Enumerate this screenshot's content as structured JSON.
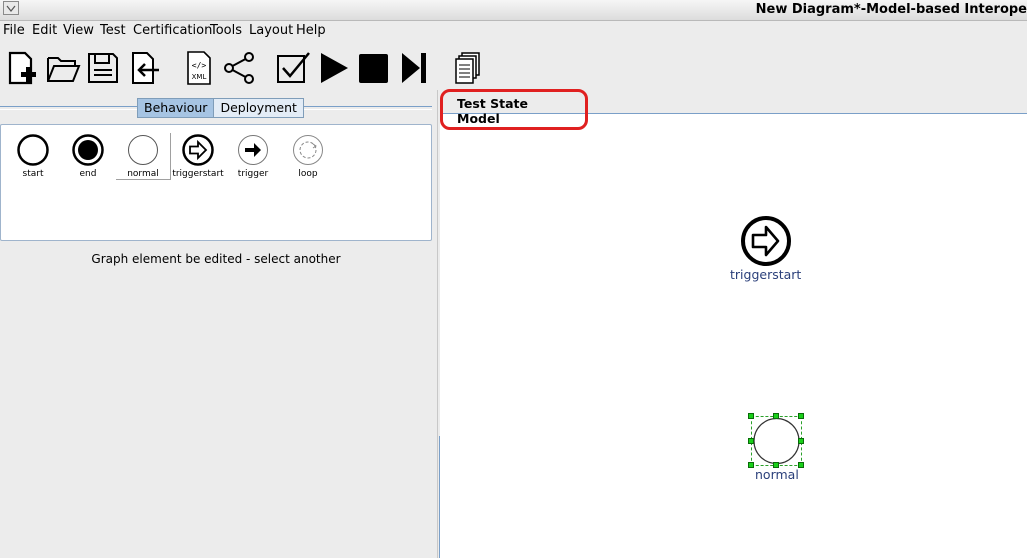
{
  "window": {
    "title": "New Diagram*-Model-based Interope"
  },
  "menu": [
    "File",
    "Edit",
    "View",
    "Test",
    "Certification",
    "Tools",
    "Layout",
    "Help"
  ],
  "toolbar": {
    "icons": [
      "new-icon",
      "open-folder-icon",
      "save-icon",
      "import-icon",
      "xml-icon",
      "share-icon",
      "validate-icon",
      "play-icon",
      "stop-icon",
      "step-icon",
      "copy-icon"
    ],
    "xml_text": "XML"
  },
  "left": {
    "tabs": [
      "Behaviour",
      "Deployment"
    ],
    "active_tab": "Behaviour",
    "palette": [
      "start",
      "end",
      "normal",
      "triggerstart",
      "trigger",
      "loop"
    ],
    "status": "Graph element be edited - select another"
  },
  "right": {
    "tab_title": "Test State Model",
    "nodes": [
      {
        "type": "triggerstart",
        "label": "triggerstart"
      },
      {
        "type": "normal",
        "label": "normal",
        "selected": true
      }
    ]
  },
  "colors": {
    "highlight": "#e02020",
    "node_label": "#2a3f7a",
    "handle": "#19d019",
    "tab_active": "#a6c4e3"
  }
}
